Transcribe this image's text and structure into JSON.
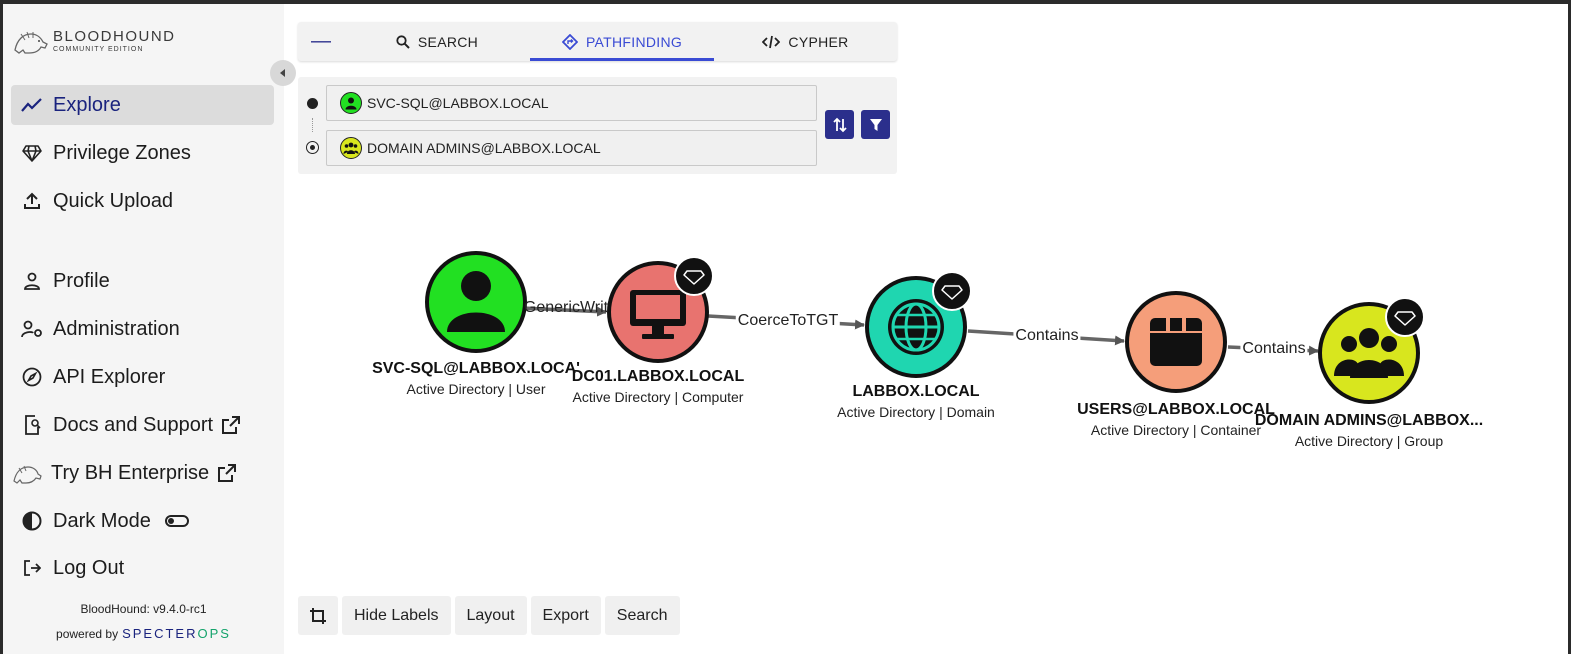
{
  "app": {
    "logo_line1": "BLOODHOUND",
    "logo_line2": "COMMUNITY EDITION",
    "version": "BloodHound: v9.4.0-rc1",
    "powered_by": "powered by",
    "vendor": "SPECTEROPS"
  },
  "sidebar": {
    "items": [
      {
        "label": "Explore",
        "icon": "trending-line-icon",
        "active": true
      },
      {
        "label": "Privilege Zones",
        "icon": "gem-icon"
      },
      {
        "label": "Quick Upload",
        "icon": "upload-icon"
      },
      {
        "label": "Profile",
        "icon": "person-icon"
      },
      {
        "label": "Administration",
        "icon": "user-gear-icon"
      },
      {
        "label": "API Explorer",
        "icon": "compass-icon"
      },
      {
        "label": "Docs and Support",
        "icon": "doc-search-icon",
        "external": true
      },
      {
        "label": "Try BH Enterprise",
        "icon": "bloodhound-dog-icon",
        "external": true
      },
      {
        "label": "Dark Mode",
        "icon": "contrast-icon",
        "toggle": false
      },
      {
        "label": "Log Out",
        "icon": "logout-icon"
      }
    ]
  },
  "tabs": {
    "minimize": "—",
    "items": [
      {
        "label": "SEARCH",
        "icon": "search-icon"
      },
      {
        "label": "PATHFINDING",
        "icon": "pathfinding-icon",
        "active": true
      },
      {
        "label": "CYPHER",
        "icon": "code-icon"
      }
    ]
  },
  "pathfinding": {
    "source": "SVC-SQL@LABBOX.LOCAL",
    "target": "DOMAIN ADMINS@LABBOX.LOCAL"
  },
  "graph": {
    "nodes": [
      {
        "name": "SVC-SQL@LABBOX.LOCA'",
        "type": "Active Directory | User",
        "color": "#22e022"
      },
      {
        "name": "DC01.LABBOX.LOCAL",
        "type": "Active Directory | Computer",
        "color": "#e8736f"
      },
      {
        "name": "LABBOX.LOCAL",
        "type": "Active Directory | Domain",
        "color": "#1fd6b0"
      },
      {
        "name": "USERS@LABBOX.LOCAL",
        "type": "Active Directory | Container",
        "color": "#f59e7a"
      },
      {
        "name": "DOMAIN ADMINS@LABBOX...",
        "type": "Active Directory | Group",
        "color": "#d8e61e"
      }
    ],
    "edges": [
      {
        "label": "GenericWrit"
      },
      {
        "label": "CoerceToTGT"
      },
      {
        "label": "Contains"
      },
      {
        "label": "Contains"
      }
    ]
  },
  "toolbar": {
    "crop_icon": "crop-icon",
    "hide_labels": "Hide Labels",
    "layout": "Layout",
    "export": "Export",
    "search": "Search"
  }
}
